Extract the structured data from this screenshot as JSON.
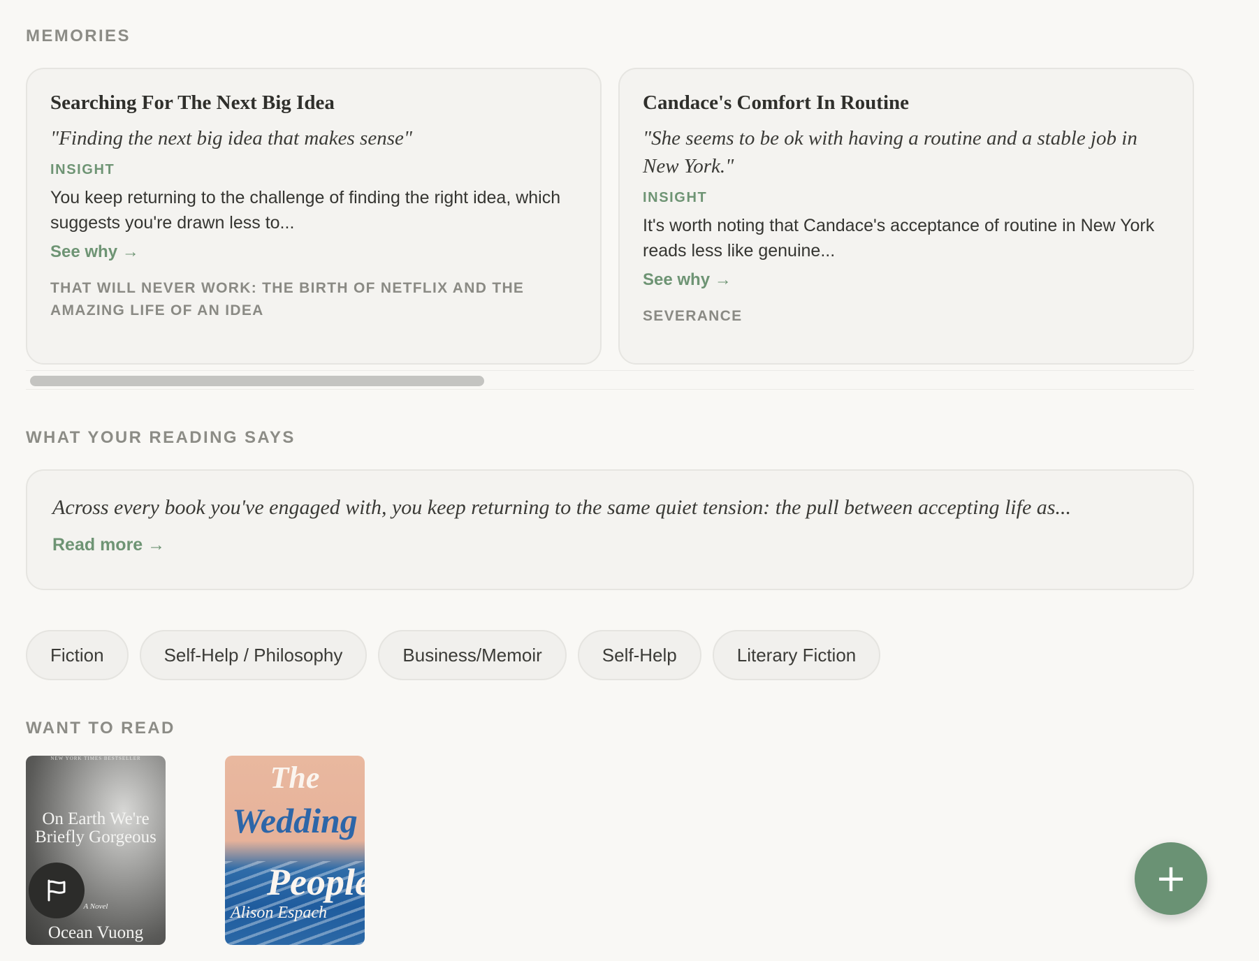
{
  "memories": {
    "section_label": "MEMORIES",
    "cards": [
      {
        "title": "Searching For The Next Big Idea",
        "quote": "\"Finding the next big idea that makes sense\"",
        "insight_label": "INSIGHT",
        "insight": "You keep returning to the challenge of finding the right idea, which suggests you're drawn less to...",
        "see_why": "See why →",
        "source": "THAT WILL NEVER WORK: THE BIRTH OF NETFLIX AND THE AMAZING LIFE OF AN IDEA"
      },
      {
        "title": "Candace's Comfort In Routine",
        "quote": "\"She seems to be ok with having a routine and a stable job in New York.\"",
        "insight_label": "INSIGHT",
        "insight": "It's worth noting that Candace's acceptance of routine in New York reads less like genuine...",
        "see_why": "See why →",
        "source": "SEVERANCE"
      }
    ]
  },
  "reading": {
    "section_label": "WHAT YOUR READING SAYS",
    "summary": "Across every book you've engaged with, you keep returning to the same quiet tension: the pull between accepting life as...",
    "read_more": "Read more →"
  },
  "genres": [
    "Fiction",
    "Self-Help / Philosophy",
    "Business/Memoir",
    "Self-Help",
    "Literary Fiction"
  ],
  "want_to_read": {
    "section_label": "WANT TO READ",
    "books": [
      {
        "top_line": "NEW YORK TIMES BESTSELLER",
        "title": "On Earth We're Briefly Gorgeous",
        "subtitle": "A Novel",
        "author": "Ocean Vuong"
      },
      {
        "title_the": "The",
        "title_word1": "Wedding",
        "title_word2": "People",
        "author": "Alison Espach"
      }
    ]
  },
  "icons": {
    "flag": "flag-icon",
    "add": "plus-icon"
  },
  "colors": {
    "accent": "#6e9474",
    "background": "#f9f8f5",
    "card": "#f4f3f0"
  }
}
